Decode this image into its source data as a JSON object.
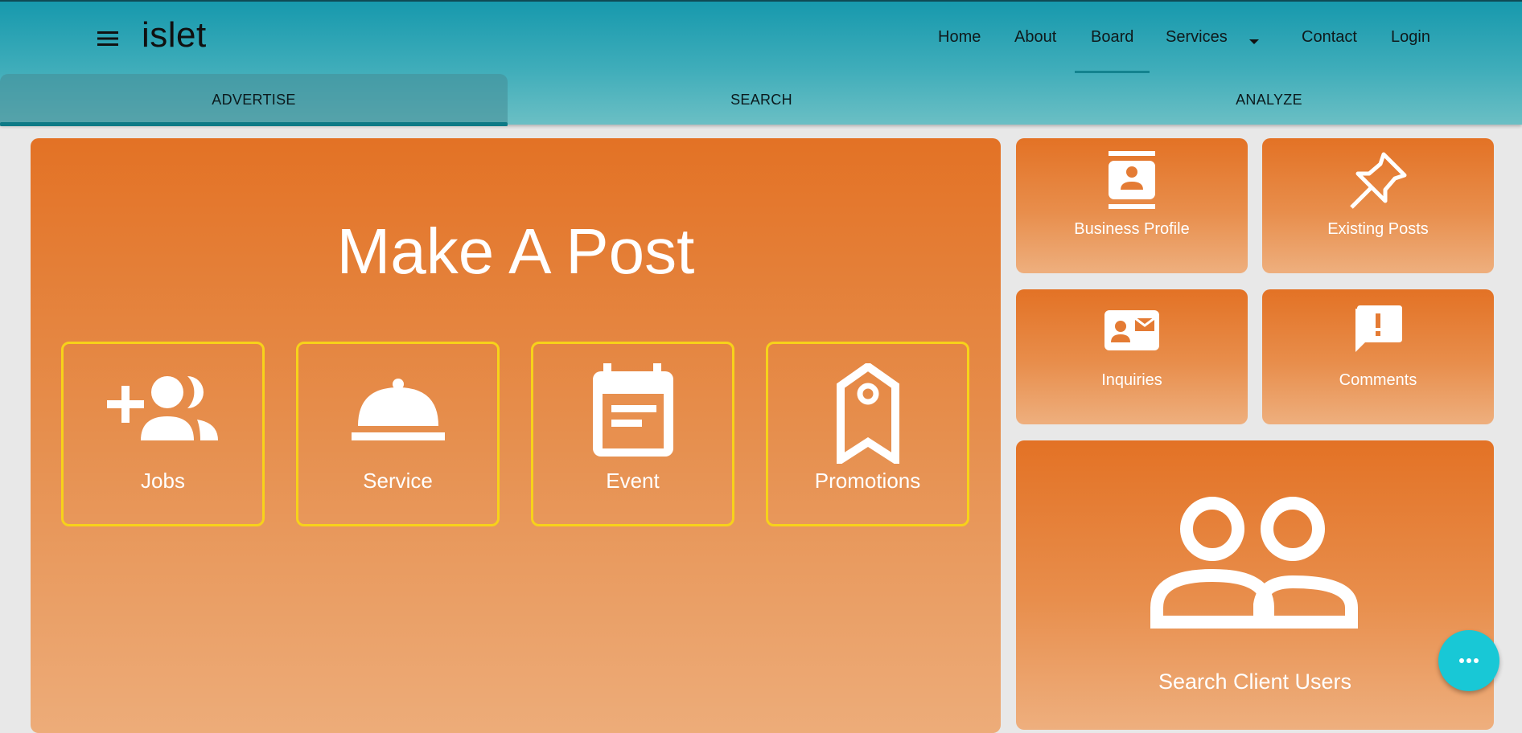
{
  "app": {
    "brand": "islet"
  },
  "nav": {
    "items": [
      {
        "label": "Home"
      },
      {
        "label": "About"
      },
      {
        "label": "Board",
        "active": true
      },
      {
        "label": "Services",
        "has_dropdown": true
      },
      {
        "label": "Contact"
      },
      {
        "label": "Login"
      }
    ]
  },
  "tabs": [
    {
      "label": "ADVERTISE",
      "active": true
    },
    {
      "label": "SEARCH"
    },
    {
      "label": "ANALYZE"
    }
  ],
  "main": {
    "title": "Make A Post",
    "tiles": [
      {
        "label": "Jobs",
        "icon": "group-add-icon"
      },
      {
        "label": "Service",
        "icon": "room-service-icon"
      },
      {
        "label": "Event",
        "icon": "event-note-icon"
      },
      {
        "label": "Promotions",
        "icon": "bookmark-tag-icon"
      }
    ]
  },
  "side": {
    "cards": [
      {
        "label": "Business Profile",
        "icon": "contact-card-icon"
      },
      {
        "label": "Existing Posts",
        "icon": "push-pin-icon"
      },
      {
        "label": "Inquiries",
        "icon": "contact-mail-icon"
      },
      {
        "label": "Comments",
        "icon": "feedback-icon"
      }
    ],
    "big_card": {
      "label": "Search Client Users",
      "icon": "people-outline-icon"
    }
  },
  "fab": {
    "icon": "more-horizontal-icon"
  },
  "colors": {
    "header_top": "#1799ad",
    "header_bottom": "#6bbfc4",
    "card_orange": "#e37225",
    "tile_border": "#f7d21a",
    "fab": "#18c8d6"
  }
}
